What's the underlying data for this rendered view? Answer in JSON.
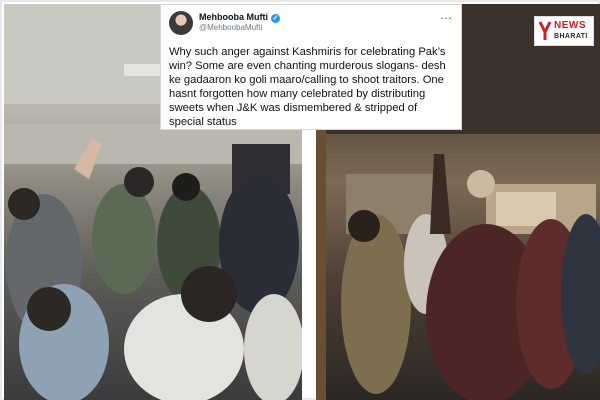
{
  "tweet": {
    "author_name": "Mehbooba Mufti",
    "handle": "@MehboobaMufti",
    "verified_icon": "verified-badge-icon",
    "menu_icon": "more-options-icon",
    "text": "Why such anger against Kashmiris for celebrating Pak’s win? Some are even chanting murderous slogans- desh ke gadaaron ko goli maaro/calling to shoot traitors. One hasnt forgotten how many celebrated by distributing sweets when J&K was dismembered & stripped of special status"
  },
  "logo": {
    "line1": "NEWS",
    "line2": "BHARATI",
    "accent_color": "#c8242b"
  },
  "colors": {
    "verified": "#1d9bf0",
    "handle": "#6b7a88"
  }
}
